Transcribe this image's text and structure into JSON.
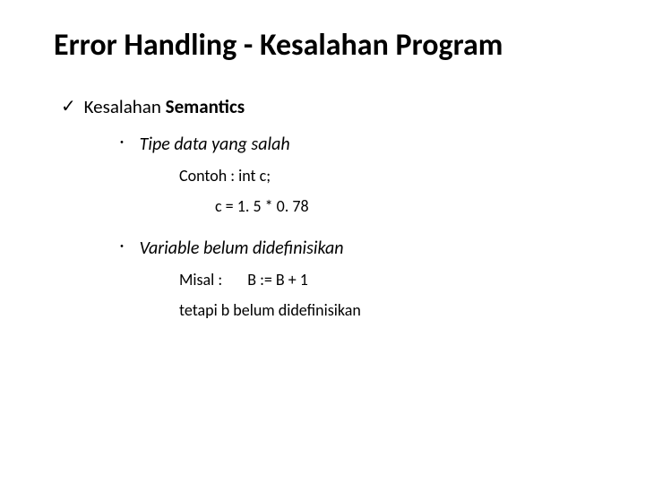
{
  "title": "Error Handling - Kesalahan Program",
  "item1": {
    "prefix": "Kesalahan ",
    "bold": "Semantics"
  },
  "sub1": {
    "text": "Tipe data yang salah",
    "example_label": "Contoh : int c;",
    "example_code": "c = 1. 5 * 0. 78"
  },
  "sub2": {
    "text": "Variable belum didefinisikan",
    "example_label": "Misal :",
    "example_code": "B := B + 1",
    "note": "tetapi b belum didefinisikan"
  }
}
